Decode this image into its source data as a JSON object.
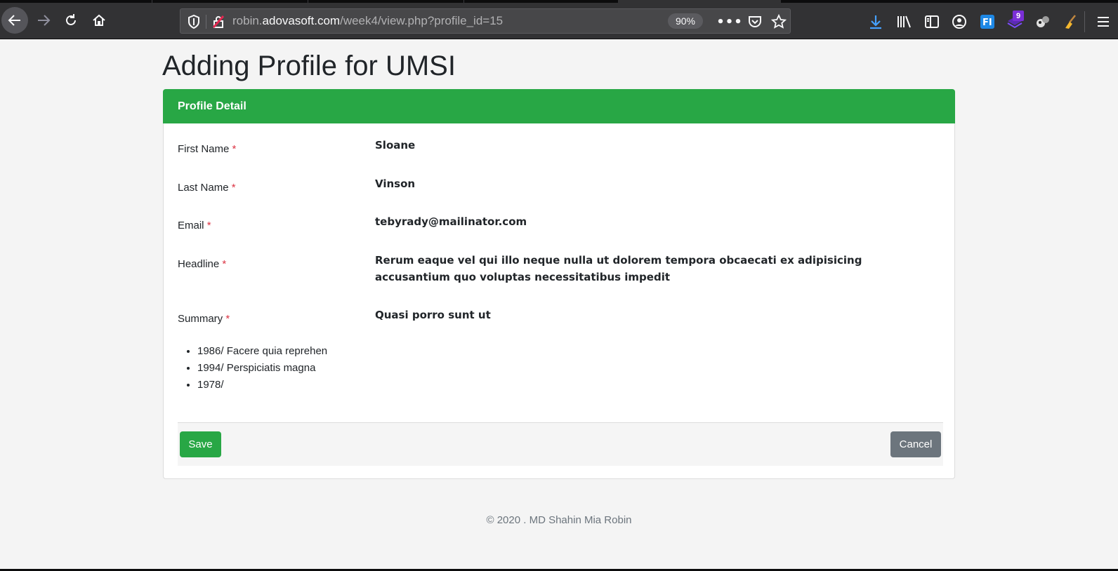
{
  "browser": {
    "url_prefix": "robin.",
    "url_host": "adovasoft.com",
    "url_path": "/week4/view.php?profile_id=15",
    "zoom": "90%",
    "more_label": "•••",
    "extension_badge": "9"
  },
  "page": {
    "title": "Adding Profile for UMSI"
  },
  "card": {
    "header": "Profile Detail",
    "required_mark": "*",
    "fields": {
      "first_name": {
        "label": "First Name",
        "value": "Sloane"
      },
      "last_name": {
        "label": "Last Name",
        "value": "Vinson"
      },
      "email": {
        "label": "Email",
        "value": "tebyrady@mailinator.com"
      },
      "headline": {
        "label": "Headline",
        "value": "Rerum eaque vel qui illo neque nulla ut dolorem tempora obcaecati ex adipisicing accusantium quo voluptas necessitatibus impedit"
      },
      "summary": {
        "label": "Summary",
        "value": "Quasi porro sunt ut"
      }
    },
    "education": [
      "1986/ Facere quia reprehen",
      "1994/ Perspiciatis magna",
      "1978/"
    ],
    "buttons": {
      "save": "Save",
      "cancel": "Cancel"
    }
  },
  "footer": {
    "text": "© 2020 . MD Shahin Mia Robin"
  },
  "colors": {
    "accent": "#28a745",
    "danger": "#dc3545",
    "secondary": "#6c757d",
    "chrome": "#323234"
  }
}
